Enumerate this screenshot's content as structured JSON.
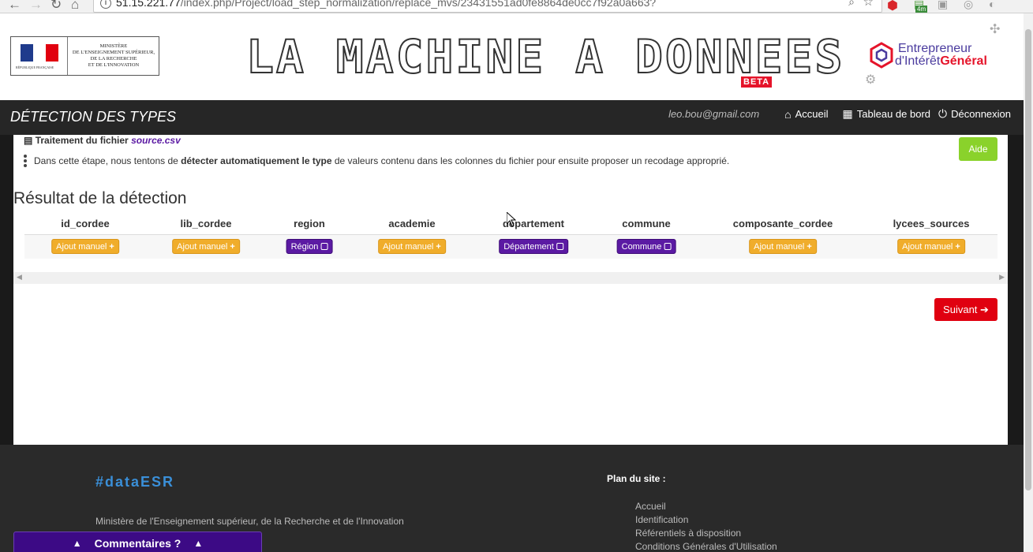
{
  "browser": {
    "url_host": "51.15.221.77",
    "url_path": "/index.php/Project/load_step_normalization/replace_mvs/23431551ad0fe8864de0cc7f92a0a663?",
    "ext_badge": "4m"
  },
  "header": {
    "ministry_lines": [
      "MINISTÈRE",
      "DE L'ENSEIGNEMENT SUPÉRIEUR,",
      "DE LA RECHERCHE",
      "ET DE L'INNOVATION"
    ],
    "republic_text": "RÉPUBLIQUE FRANÇAISE",
    "logo_title": "LA MACHINE A DONNEES",
    "beta_label": "BETA",
    "eig_line1": "Entrepreneur",
    "eig_line2a": "d'Intérêt",
    "eig_line2b": "Général"
  },
  "titlebar": {
    "title": "DÉTECTION DES TYPES",
    "user_email": "leo.bou@gmail.com",
    "nav": [
      "Accueil",
      "Tableau de bord",
      "Déconnexion"
    ]
  },
  "panel": {
    "file_label": "Traitement du fichier",
    "file_name": "source.csv",
    "desc_before": "Dans cette étape, nous tentons de",
    "desc_bold": "détecter automatiquement le type",
    "desc_after": "de valeurs contenu dans les colonnes du fichier pour ensuite proposer un recodage approprié.",
    "aide_label": "Aide",
    "result_title": "Résultat de la détection",
    "columns": [
      {
        "name": "id_cordee",
        "button": "Ajout manuel",
        "kind": "manual"
      },
      {
        "name": "lib_cordee",
        "button": "Ajout manuel",
        "kind": "manual"
      },
      {
        "name": "region",
        "button": "Région",
        "kind": "detected"
      },
      {
        "name": "academie",
        "button": "Ajout manuel",
        "kind": "manual"
      },
      {
        "name": "departement",
        "button": "Département",
        "kind": "detected"
      },
      {
        "name": "commune",
        "button": "Commune",
        "kind": "detected"
      },
      {
        "name": "composante_cordee",
        "button": "Ajout manuel",
        "kind": "manual"
      },
      {
        "name": "lycees_sources",
        "button": "Ajout manuel",
        "kind": "manual"
      }
    ],
    "next_label": "Suivant"
  },
  "footer": {
    "brand": "#dataESR",
    "ministry": "Ministère de l'Enseignement supérieur, de la Recherche et de l'Innovation",
    "plan_title": "Plan du site :",
    "plan_links": [
      "Accueil",
      "Identification",
      "Référentiels à disposition",
      "Conditions Générales d'Utilisation"
    ],
    "comments_label": "Commentaires ?"
  },
  "colors": {
    "manual_button": "#f0ad2b",
    "detected_button": "#5b1aa3",
    "next_button": "#e00010",
    "aide_button": "#8ad22b"
  }
}
